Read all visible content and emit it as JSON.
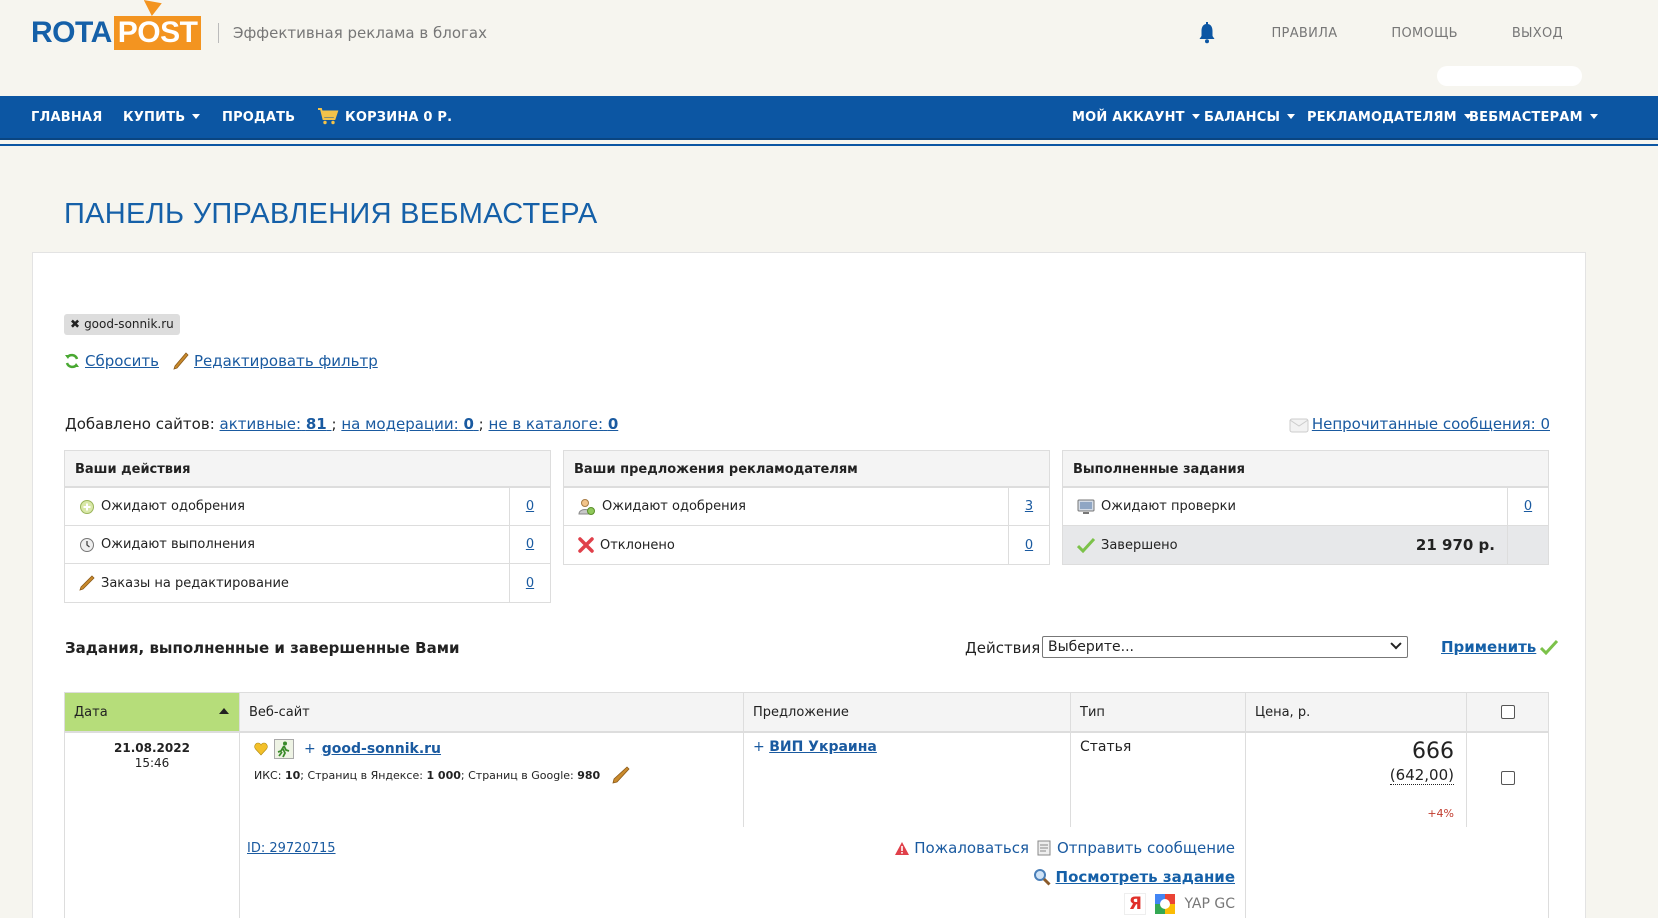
{
  "header": {
    "logo_left": "ROTA",
    "logo_right": "POST",
    "tagline": "Эффективная реклама в блогах",
    "links": [
      "ПРАВИЛА",
      "ПОМОЩЬ",
      "ВЫХОД"
    ]
  },
  "nav": {
    "left": [
      "ГЛАВНАЯ",
      "КУПИТЬ",
      "ПРОДАТЬ",
      "КОРЗИНА 0 Р."
    ],
    "right": [
      "МОЙ АККАУНТ",
      "БАЛАНСЫ",
      "РЕКЛАМОДАТЕЛЯМ",
      "ВЕБМАСТЕРАМ"
    ]
  },
  "page_title": "ПАНЕЛЬ УПРАВЛЕНИЯ ВЕБМАСТЕРА",
  "filter": {
    "tag": "good-sonnik.ru",
    "reset": "Сбросить",
    "edit": "Редактировать фильтр"
  },
  "sites": {
    "label": "Добавлено сайтов:",
    "active_label": "активные:",
    "active_count": "81",
    "moderation_label": "на модерации:",
    "moderation_count": "0",
    "not_in_catalog_label": "не в каталоге:",
    "not_in_catalog_count": "0",
    "sep": ";",
    "unread_label": "Непрочитанные сообщения: 0"
  },
  "boxes": {
    "your_actions": {
      "title": "Ваши действия",
      "rows": [
        {
          "label": "Ожидают одобрения",
          "value": "0"
        },
        {
          "label": "Ожидают выполнения",
          "value": "0"
        },
        {
          "label": "Заказы на редактирование",
          "value": "0"
        }
      ]
    },
    "offers": {
      "title": "Ваши предложения рекламодателям",
      "rows": [
        {
          "label": "Ожидают одобрения",
          "value": "3"
        },
        {
          "label": "Отклонено",
          "value": "0"
        }
      ]
    },
    "completed": {
      "title": "Выполненные задания",
      "rows": [
        {
          "label": "Ожидают проверки",
          "value": "0"
        },
        {
          "label": "Завершено",
          "value": "21 970 р."
        }
      ]
    }
  },
  "tasks": {
    "title": "Задания, выполненные и завершенные Вами",
    "actions_label": "Действия:",
    "select_value": "Выберите...",
    "apply": "Применить",
    "columns": [
      "Дата",
      "Веб-сайт",
      "Предложение",
      "Тип",
      "Цена, р."
    ],
    "rows": [
      {
        "date": "21.08.2022",
        "time": "15:46",
        "site": "good-sonnik.ru",
        "site_prefix": "+",
        "metrics_prefix": "ИКС:",
        "iks": "10",
        "yandex_label": "; Страниц в Яндексе:",
        "yandex_pages": "1 000",
        "google_label": "; Страниц в Google:",
        "google_pages": "980",
        "offer_prefix": "+",
        "offer": "ВИП Украина",
        "type": "Статья",
        "price": "666",
        "price_net": "(642,00)",
        "price_change": "+4%",
        "id": "ID: 29720715",
        "complain": "Пожаловаться",
        "send_message": "Отправить сообщение",
        "view_task": "Посмотреть задание",
        "yandex_letter": "Я",
        "engines_text": "YAP GC"
      }
    ]
  }
}
